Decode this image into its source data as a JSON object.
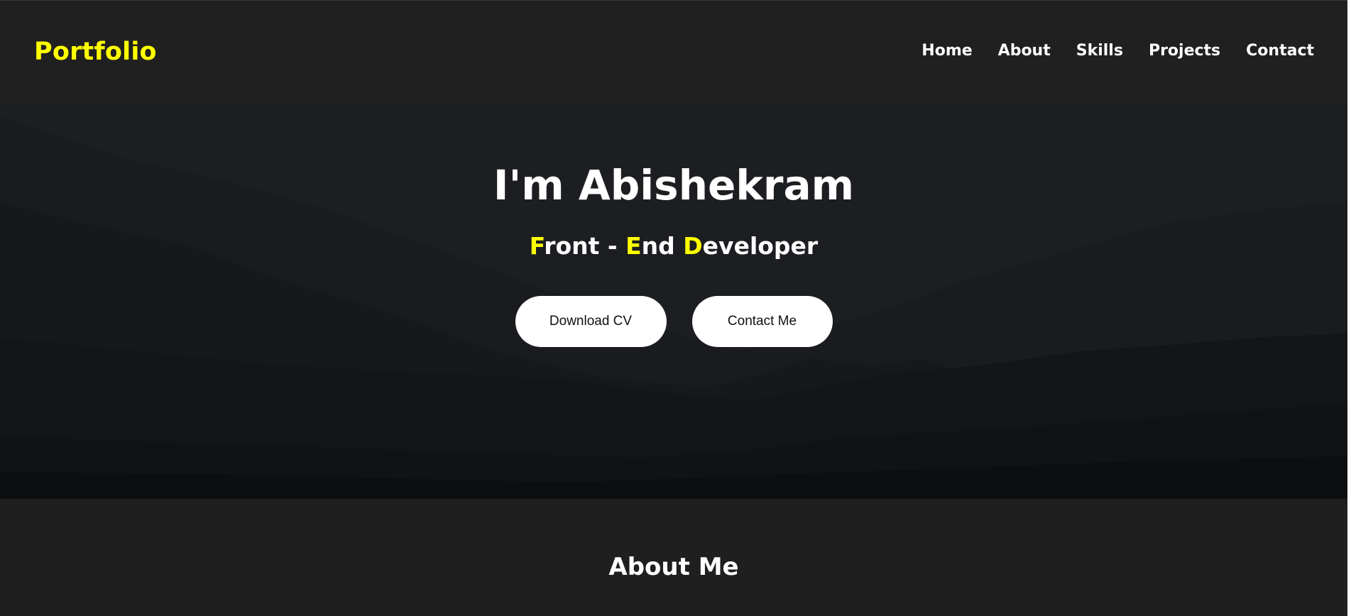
{
  "header": {
    "logo": "Portfolio",
    "nav": [
      "Home",
      "About",
      "Skills",
      "Projects",
      "Contact"
    ]
  },
  "hero": {
    "title": "I'm Abishekram",
    "subtitle": {
      "part1_hl": "F",
      "part1": "ront - ",
      "part2_hl": "E",
      "part2": "nd ",
      "part3_hl": "D",
      "part3": "eveloper"
    },
    "buttons": {
      "download": "Download CV",
      "contact": "Contact Me"
    }
  },
  "about": {
    "title": "About Me"
  },
  "colors": {
    "accent": "#ffff00",
    "background": "#1f1f1f",
    "hero_background": "#15171b",
    "button": "#ffffff"
  }
}
